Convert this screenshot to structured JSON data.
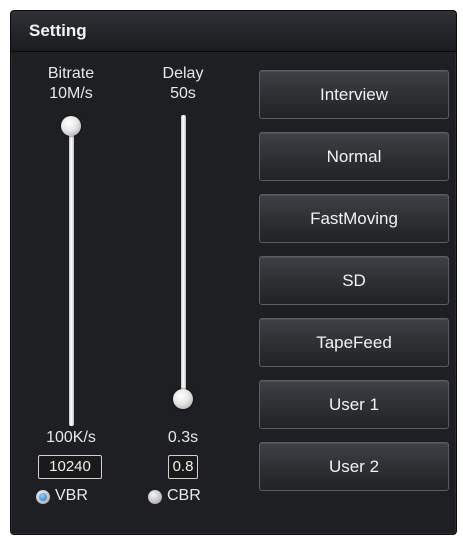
{
  "window": {
    "title": "Setting"
  },
  "bitrate": {
    "label": "Bitrate",
    "max_label": "10M/s",
    "min_label": "100K/s",
    "value": "10240",
    "level": 1.0
  },
  "delay": {
    "label": "Delay",
    "max_label": "50s",
    "min_label": "0.3s",
    "value": "0.8",
    "level": 0.0
  },
  "mode": {
    "options": [
      {
        "label": "VBR",
        "selected": true
      },
      {
        "label": "CBR",
        "selected": false
      }
    ]
  },
  "presets": [
    "Interview",
    "Normal",
    "FastMoving",
    "SD",
    "TapeFeed",
    "User 1",
    "User 2"
  ],
  "colors": {
    "panel": "#1d1f22",
    "accent": "#1b76c6",
    "text": "#f2f2f2"
  }
}
